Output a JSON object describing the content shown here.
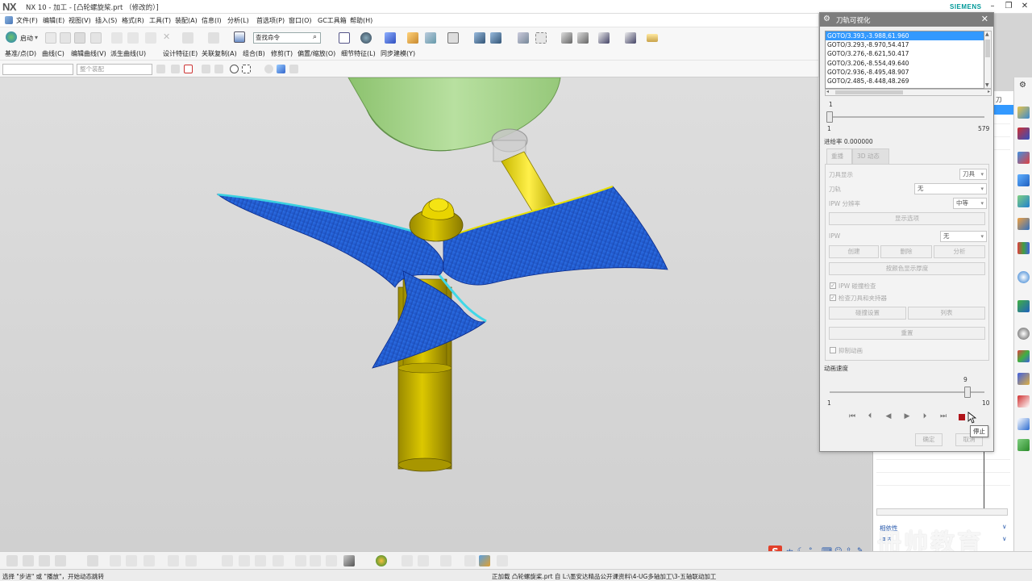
{
  "window": {
    "logo": "NX",
    "title": "NX 10 - 加工 - [凸轮螺旋桨.prt （修改的）]",
    "brand": "SIEMENS"
  },
  "menu": [
    "文件(F)",
    "编辑(E)",
    "视图(V)",
    "插入(S)",
    "格式(R)",
    "工具(T)",
    "装配(A)",
    "信息(I)",
    "分析(L)",
    "首选项(P)",
    "窗口(O)",
    "GC工具箱",
    "帮助(H)"
  ],
  "toolbar": {
    "start_label": "启动",
    "command_search": "查找命令"
  },
  "toolbar2": [
    "基准/点(D)",
    "曲线(C)",
    "编辑曲线(V)",
    "派生曲线(U)",
    "设计特征(E)",
    "关联复制(A)",
    "组合(B)",
    "修剪(T)",
    "偏置/缩放(O)",
    "细节特征(L)",
    "同步建模(Y)"
  ],
  "selection_bar": {
    "filter_placeholder": "",
    "scope": "整个装配"
  },
  "dialog": {
    "title": "刀轨可视化",
    "goto_list": [
      "GOTO/3.393,-3.988,61.960",
      "GOTO/3.293,-8.970,54.417",
      "GOTO/3.276,-8.621,50.417",
      "GOTO/3.206,-8.554,49.640",
      "GOTO/2.936,-8.495,48.907",
      "GOTO/2.485,-8.448,48.269"
    ],
    "selected_index": 0,
    "slider_value": "1",
    "slider_min": "1",
    "slider_max": "579",
    "slider_position": 1,
    "feed_rate": "进给率 0.000000",
    "tabs": [
      "重播",
      "3D 动态"
    ],
    "tool_display_label": "刀具显示",
    "tool_display_value": "刀具",
    "toolpath_label": "刀轨",
    "toolpath_value": "无",
    "ipw_res_label": "IPW 分辨率",
    "ipw_res_value": "中等",
    "show_options": "显示选项",
    "ipw_label": "IPW",
    "ipw_value": "无",
    "btn_create": "创建",
    "btn_delete": "删除",
    "btn_analyze": "分析",
    "btn_color_thickness": "按颜色显示厚度",
    "chk_ipw_collision": "IPW 碰撞检查",
    "chk_tool_holder": "检查刀具和夹持器",
    "btn_collision_settings": "碰撞设置",
    "btn_list": "列表",
    "btn_reset": "重置",
    "chk_suppress_anim": "抑制动画",
    "anim_speed_label": "动画速度",
    "speed_value": "9",
    "speed_min": "1",
    "speed_max": "10",
    "speed_fraction": 0.89,
    "ok_label": "确定",
    "cancel_label": "取消"
  },
  "tooltip": "停止",
  "navigator": {
    "tab_label": "刀"
  },
  "navigator_bottom": {
    "dependency": "相依性",
    "details": "细节"
  },
  "status": {
    "left": "选择 \"步进\" 或 \"播放\"，开始动态跳转",
    "right": "正加载 凸轮螺旋桨.prt 自 L:\\墨安达精品公开课资料\\4-UG多轴加工\\3-五轴联动加工"
  },
  "watermark": "冊帅教育",
  "ime": "中",
  "colors": {
    "accent": "#3399ff",
    "blade": "#2a6ae0",
    "hub": "#c8b400",
    "tool_holder": "#a6d48a",
    "stop": "#b0141a"
  }
}
